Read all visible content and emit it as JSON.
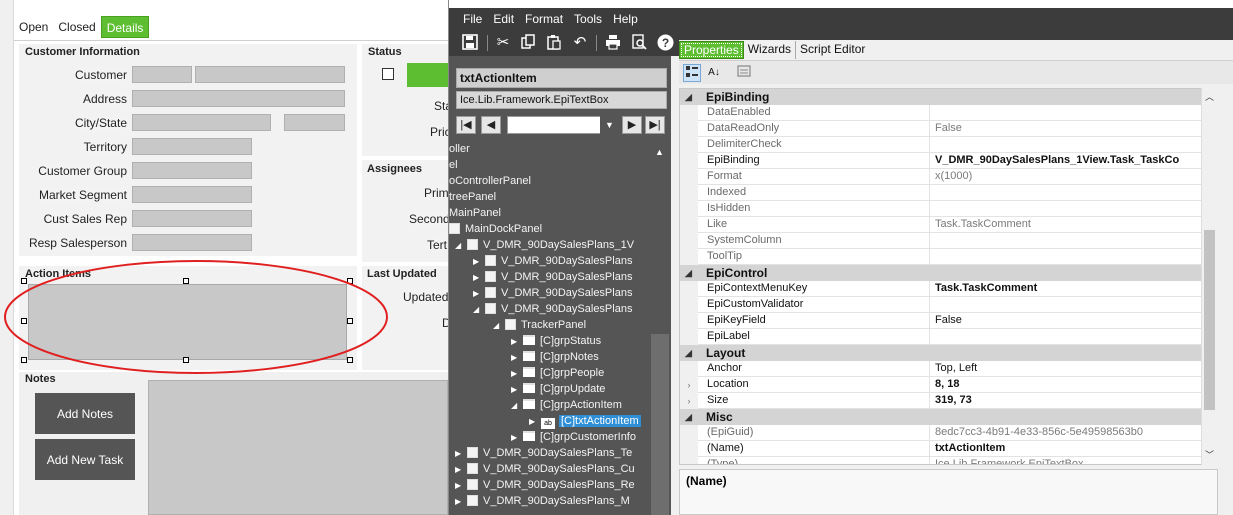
{
  "form": {
    "tabs": [
      {
        "label": "Open"
      },
      {
        "label": "Closed"
      },
      {
        "label": "Details"
      }
    ],
    "customer_info": {
      "title": "Customer Information",
      "labels": [
        "Customer",
        "Address",
        "City/State",
        "Territory",
        "Customer Group",
        "Market Segment",
        "Cust Sales Rep",
        "Resp Salesperson"
      ]
    },
    "status": {
      "title": "Status",
      "partial_labels": [
        "Sta",
        "Pric"
      ]
    },
    "assignees": {
      "title": "Assignees",
      "partial_labels": [
        "Prim",
        "Second",
        "Tert"
      ]
    },
    "action_items": {
      "title": "Action Items"
    },
    "last_updated": {
      "title": "Last Updated",
      "partial_labels": [
        "Updated",
        "D"
      ]
    },
    "notes": {
      "title": "Notes",
      "add_notes_label": "Add Notes",
      "add_new_task_label": "Add New Task"
    }
  },
  "designer": {
    "menu": [
      "File",
      "Edit",
      "Format",
      "Tools",
      "Help"
    ],
    "toolbar_icons": [
      "save-icon",
      "cut-icon",
      "copy-icon",
      "paste-icon",
      "undo-icon",
      "print-icon",
      "print-preview-icon",
      "help-icon"
    ],
    "tree": {
      "header": "txtActionItem",
      "type": "Ice.Lib.Framework.EpiTextBox",
      "items": [
        {
          "label": "oller",
          "kind": "plain"
        },
        {
          "label": "el",
          "kind": "plain"
        },
        {
          "label": "oControllerPanel",
          "kind": "plain"
        },
        {
          "label": "treePanel",
          "kind": "plain"
        },
        {
          "label": "MainPanel",
          "kind": "plain"
        },
        {
          "label": "MainDockPanel",
          "kind": "box"
        },
        {
          "label": "V_DMR_90DaySalesPlans_1V",
          "kind": "box"
        },
        {
          "label": "V_DMR_90DaySalesPlans",
          "kind": "box"
        },
        {
          "label": "V_DMR_90DaySalesPlans",
          "kind": "box"
        },
        {
          "label": "V_DMR_90DaySalesPlans",
          "kind": "box"
        },
        {
          "label": "V_DMR_90DaySalesPlans",
          "kind": "box"
        },
        {
          "label": "TrackerPanel",
          "kind": "box"
        },
        {
          "label": "[C]grpStatus",
          "kind": "folder"
        },
        {
          "label": "[C]grpNotes",
          "kind": "folder"
        },
        {
          "label": "[C]grpPeople",
          "kind": "folder"
        },
        {
          "label": "[C]grpUpdate",
          "kind": "folder"
        },
        {
          "label": "[C]grpActionItem",
          "kind": "folder"
        },
        {
          "label": "[C]txtActionItem",
          "kind": "textbox"
        },
        {
          "label": "[C]grpCustomerInfo",
          "kind": "folder"
        },
        {
          "label": "V_DMR_90DaySalesPlans_Te",
          "kind": "box"
        },
        {
          "label": "V_DMR_90DaySalesPlans_Cu",
          "kind": "box"
        },
        {
          "label": "V_DMR_90DaySalesPlans_Re",
          "kind": "box"
        },
        {
          "label": "V_DMR_90DaySalesPlans_M",
          "kind": "box"
        }
      ]
    },
    "prop_tabs": [
      "Properties",
      "Wizards",
      "Script Editor"
    ],
    "properties": [
      {
        "type": "cat",
        "name": "EpiBinding"
      },
      {
        "type": "row",
        "name": "DataEnabled",
        "value": "",
        "active": false,
        "bold": false
      },
      {
        "type": "row",
        "name": "DataReadOnly",
        "value": "False",
        "active": false,
        "bold": false
      },
      {
        "type": "row",
        "name": "DelimiterCheck",
        "value": "",
        "active": false,
        "bold": false
      },
      {
        "type": "row",
        "name": "EpiBinding",
        "value": "V_DMR_90DaySalesPlans_1View.Task_TaskCo",
        "active": true,
        "bold": true
      },
      {
        "type": "row",
        "name": "Format",
        "value": "x(1000)",
        "active": false,
        "bold": false
      },
      {
        "type": "row",
        "name": "Indexed",
        "value": "",
        "active": false,
        "bold": false
      },
      {
        "type": "row",
        "name": "IsHidden",
        "value": "",
        "active": false,
        "bold": false
      },
      {
        "type": "row",
        "name": "Like",
        "value": "Task.TaskComment",
        "active": false,
        "bold": false
      },
      {
        "type": "row",
        "name": "SystemColumn",
        "value": "",
        "active": false,
        "bold": false
      },
      {
        "type": "row",
        "name": "ToolTip",
        "value": "",
        "active": false,
        "bold": false
      },
      {
        "type": "cat",
        "name": "EpiControl"
      },
      {
        "type": "row",
        "name": "EpiContextMenuKey",
        "value": "Task.TaskComment",
        "active": true,
        "bold": true
      },
      {
        "type": "row",
        "name": "EpiCustomValidator",
        "value": "",
        "active": true,
        "bold": false
      },
      {
        "type": "row",
        "name": "EpiKeyField",
        "value": "False",
        "active": true,
        "bold": false
      },
      {
        "type": "row",
        "name": "EpiLabel",
        "value": "",
        "active": true,
        "bold": false
      },
      {
        "type": "cat",
        "name": "Layout"
      },
      {
        "type": "row",
        "name": "Anchor",
        "value": "Top, Left",
        "active": true,
        "bold": false
      },
      {
        "type": "row",
        "name": "Location",
        "value": "8, 18",
        "active": true,
        "bold": true,
        "expander": true
      },
      {
        "type": "row",
        "name": "Size",
        "value": "319, 73",
        "active": true,
        "bold": true,
        "expander": true
      },
      {
        "type": "cat",
        "name": "Misc"
      },
      {
        "type": "row",
        "name": "(EpiGuid)",
        "value": "8edc7cc3-4b91-4e33-856c-5e49598563b0",
        "active": false,
        "bold": false
      },
      {
        "type": "row",
        "name": "(Name)",
        "value": "txtActionItem",
        "active": true,
        "bold": true
      },
      {
        "type": "row",
        "name": "(Type)",
        "value": "Ice.Lib.Framework.EpiTextBox",
        "active": false,
        "bold": false
      }
    ],
    "description_title": "(Name)"
  },
  "colors": {
    "accent_green": "#5dbe31",
    "dark_panel": "#555555",
    "menubar": "#3c3c3c",
    "selection_blue": "#2f8fd6",
    "annotation_red": "#e02020"
  }
}
